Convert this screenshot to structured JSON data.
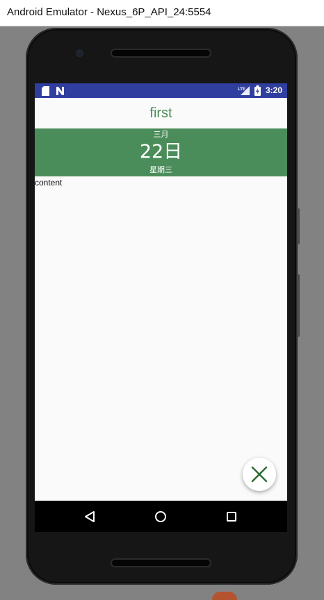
{
  "window": {
    "title": "Android Emulator - Nexus_6P_API_24:5554"
  },
  "status_bar": {
    "time": "3:20",
    "color": "#303f9f",
    "left_icons": [
      "sd-card-icon",
      "n-notification-icon"
    ],
    "right_icons": [
      "lte-signal-icon",
      "battery-charging-icon"
    ]
  },
  "app": {
    "title": "first",
    "accent_color": "#4b8d5a",
    "date": {
      "month": "三月",
      "day": "22日",
      "weekday": "星期三"
    },
    "content": "content",
    "fab_icon": "close-icon"
  },
  "nav_bar": {
    "buttons": [
      "back-icon",
      "home-icon",
      "recents-icon"
    ]
  }
}
